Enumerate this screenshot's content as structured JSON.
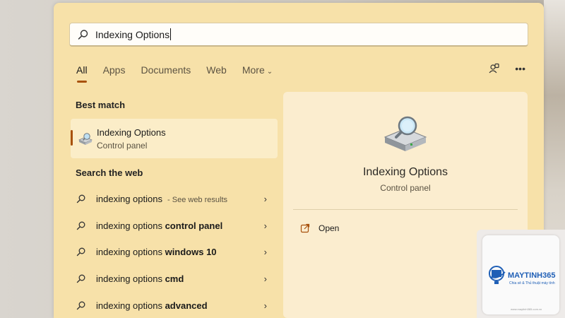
{
  "search": {
    "value": "Indexing Options"
  },
  "tabs": [
    {
      "label": "All"
    },
    {
      "label": "Apps"
    },
    {
      "label": "Documents"
    },
    {
      "label": "Web"
    },
    {
      "label": "More"
    }
  ],
  "toolbar": {
    "share_icon": "people-share-icon",
    "more_label": "•••"
  },
  "best_match": {
    "heading": "Best match",
    "title": "Indexing Options",
    "subtitle": "Control panel",
    "icon": "indexing-options-icon"
  },
  "search_web": {
    "heading": "Search the web",
    "rows": [
      {
        "prefix": "indexing options",
        "bold": "",
        "hint": " - See web results"
      },
      {
        "prefix": "indexing options ",
        "bold": "control panel",
        "hint": ""
      },
      {
        "prefix": "indexing options ",
        "bold": "windows 10",
        "hint": ""
      },
      {
        "prefix": "indexing options ",
        "bold": "cmd",
        "hint": ""
      },
      {
        "prefix": "indexing options ",
        "bold": "advanced",
        "hint": ""
      }
    ]
  },
  "preview": {
    "title": "Indexing Options",
    "subtitle": "Control panel",
    "open_label": "Open"
  },
  "watermark": {
    "brand": "MAYTINH365",
    "tagline": "Chia sẻ & Thủ thuật máy tính",
    "url": "www.maytinh365.com.vn"
  },
  "colors": {
    "panel": "#f7e1a9",
    "accent": "#a8510d",
    "logo_blue": "#1f5fb6"
  }
}
